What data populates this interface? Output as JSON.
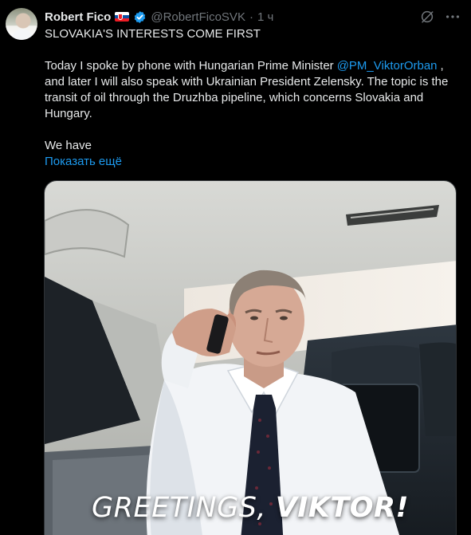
{
  "tweet": {
    "display_name": "Robert Fico",
    "handle": "@RobertFicoSVK",
    "separator": "·",
    "time": "1 ч",
    "verified": true,
    "flag": "slovakia-flag",
    "icons": {
      "grok": "grok-icon",
      "more": "more-icon"
    },
    "headline": "SLOVAKIA'S INTERESTS COME FIRST",
    "paragraph_before_mention": "Today I spoke by phone with Hungarian Prime Minister",
    "mention": "@PM_ViktorOrban",
    "paragraph_after_mention": ", and later I will also speak with Ukrainian President Zelensky. The topic is the transit of oil through the Druzhba pipeline, which concerns Slovakia and Hungary.",
    "truncated_text": "We have",
    "show_more": "Показать ещё"
  },
  "media": {
    "caption_part1": "GREETINGS, ",
    "caption_part2": "VIKTOR!"
  },
  "colors": {
    "background": "#000000",
    "text": "#e7e9ea",
    "secondary": "#71767b",
    "link": "#1d9bf0",
    "verified": "#1d9bf0"
  }
}
